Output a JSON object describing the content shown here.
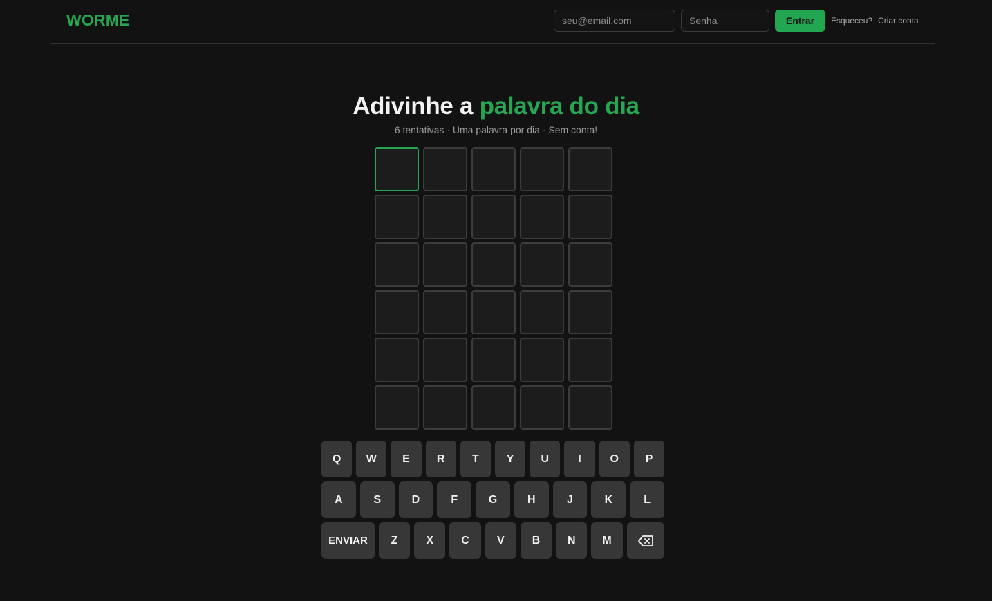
{
  "header": {
    "logo": "WORME",
    "email_placeholder": "seu@email.com",
    "password_placeholder": "Senha",
    "login_label": "Entrar",
    "forgot_label": "Esqueceu?",
    "create_label": "Criar conta"
  },
  "hero": {
    "title_prefix": "Adivinhe a",
    "title_highlight": "palavra do dia",
    "subtitle": "6 tentativas · Uma palavra por dia · Sem conta!"
  },
  "board": {
    "rows": [
      [
        "",
        "",
        "",
        "",
        ""
      ],
      [
        "",
        "",
        "",
        "",
        ""
      ],
      [
        "",
        "",
        "",
        "",
        ""
      ],
      [
        "",
        "",
        "",
        "",
        ""
      ],
      [
        "",
        "",
        "",
        "",
        ""
      ],
      [
        "",
        "",
        "",
        "",
        ""
      ]
    ]
  },
  "keyboard": {
    "rows": [
      [
        "Q",
        "W",
        "E",
        "R",
        "T",
        "Y",
        "U",
        "I",
        "O",
        "P"
      ],
      [
        "A",
        "S",
        "D",
        "F",
        "G",
        "H",
        "J",
        "K",
        "L"
      ],
      [
        "ENVIAR",
        "Z",
        "X",
        "C",
        "V",
        "B",
        "N",
        "M",
        "backspace-icon"
      ]
    ]
  },
  "colors": {
    "accent": "#27a552",
    "background": "#121212",
    "tile_border": "#3c3c3c",
    "key_bg": "#373737"
  }
}
